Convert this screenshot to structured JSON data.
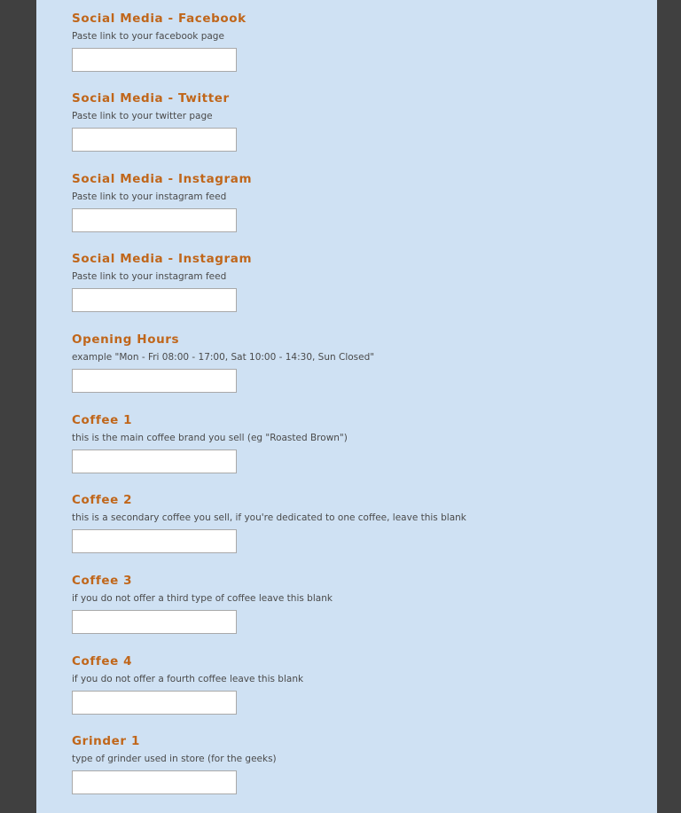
{
  "form": {
    "fields": [
      {
        "label": "Social Media - Facebook",
        "help": "Paste link to your facebook page",
        "value": ""
      },
      {
        "label": "Social Media - Twitter",
        "help": "Paste link to your twitter page",
        "value": ""
      },
      {
        "label": "Social Media - Instagram",
        "help": "Paste link to your instagram feed",
        "value": ""
      },
      {
        "label": "Social Media - Instagram",
        "help": "Paste link to your instagram feed",
        "value": ""
      },
      {
        "label": "Opening Hours",
        "help": "example \"Mon - Fri 08:00 - 17:00, Sat 10:00 - 14:30, Sun Closed\"",
        "value": ""
      },
      {
        "label": "Coffee 1",
        "help": "this is the main coffee brand you sell (eg \"Roasted Brown\")",
        "value": ""
      },
      {
        "label": "Coffee 2",
        "help": "this is a secondary coffee you sell, if you're dedicated to one coffee, leave this blank",
        "value": ""
      },
      {
        "label": "Coffee 3",
        "help": "if you do not offer a third type of coffee leave this blank",
        "value": ""
      },
      {
        "label": "Coffee 4",
        "help": "if you do not offer a fourth coffee leave this blank",
        "value": ""
      },
      {
        "label": "Grinder 1",
        "help": "type of grinder used in store (for the geeks)",
        "value": ""
      }
    ]
  },
  "colors": {
    "background": "#404040",
    "panel": "#cfe1f3",
    "label": "#c0661a",
    "help_text": "#4a4a4a"
  }
}
